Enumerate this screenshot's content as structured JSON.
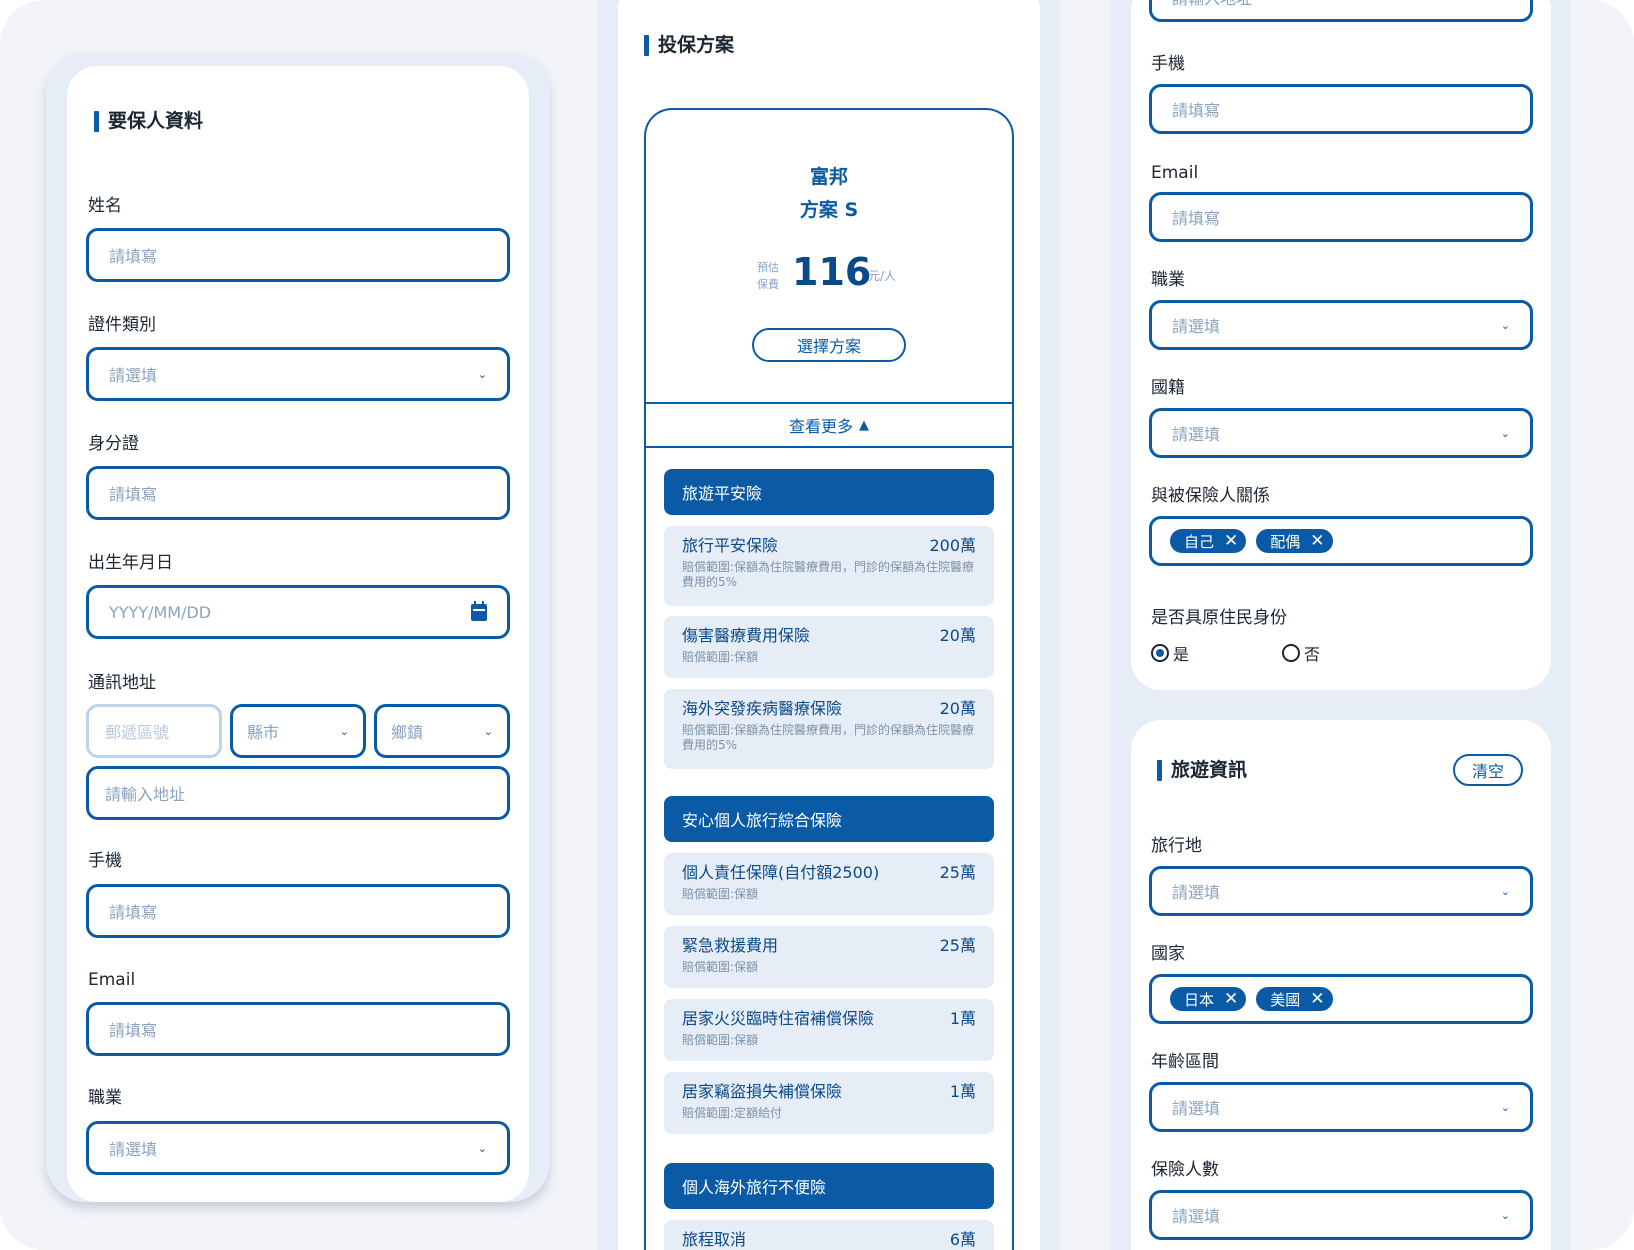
{
  "policyholder": {
    "title": "要保人資料",
    "name": {
      "label": "姓名",
      "placeholder": "請填寫"
    },
    "id_type": {
      "label": "證件類別",
      "placeholder": "請選填"
    },
    "id_number": {
      "label": "身分證",
      "placeholder": "請填寫"
    },
    "birthday": {
      "label": "出生年月日",
      "placeholder": "YYYY/MM/DD"
    },
    "address": {
      "label": "通訊地址",
      "zip_placeholder": "郵遞區號",
      "city_placeholder": "縣市",
      "town_placeholder": "鄉鎮",
      "street_placeholder": "請輸入地址"
    },
    "mobile": {
      "label": "手機",
      "placeholder": "請填寫"
    },
    "email": {
      "label": "Email",
      "placeholder": "請填寫"
    },
    "job": {
      "label": "職業",
      "placeholder": "請選填"
    }
  },
  "plan": {
    "title": "投保方案",
    "insurer": "富邦",
    "plan_name": "方案 S",
    "premium_label_1": "預估",
    "premium_label_2": "保費",
    "premium": "116",
    "premium_unit": "元/人",
    "select_button": "選擇方案",
    "more_label": "查看更多",
    "categories": [
      {
        "name": "旅遊平安險",
        "items": [
          {
            "name": "旅行平安保險",
            "amount": "200萬",
            "desc": "賠償範圍:保額為住院醫療費用，門診的保額為住院醫療費用的5%"
          },
          {
            "name": "傷害醫療費用保險",
            "amount": "20萬",
            "desc": "賠償範圍:保額"
          },
          {
            "name": "海外突發疾病醫療保險",
            "amount": "20萬",
            "desc": "賠償範圍:保額為住院醫療費用，門診的保額為住院醫療費用的5%"
          }
        ]
      },
      {
        "name": "安心個人旅行綜合保險",
        "items": [
          {
            "name": "個人責任保障(自付額2500)",
            "amount": "25萬",
            "desc": "賠償範圍:保額"
          },
          {
            "name": "緊急救援費用",
            "amount": "25萬",
            "desc": "賠償範圍:保額"
          },
          {
            "name": "居家火災臨時住宿補償保險",
            "amount": "1萬",
            "desc": "賠償範圍:保額"
          },
          {
            "name": "居家竊盜損失補償保險",
            "amount": "1萬",
            "desc": "賠償範圍:定額給付"
          }
        ]
      },
      {
        "name": "個人海外旅行不便險",
        "items": [
          {
            "name": "旅程取消",
            "amount": "6萬",
            "desc": ""
          }
        ]
      }
    ]
  },
  "right": {
    "top_address_placeholder": "請輸入地址",
    "mobile": {
      "label": "手機",
      "placeholder": "請填寫"
    },
    "email": {
      "label": "Email",
      "placeholder": "請填寫"
    },
    "job": {
      "label": "職業",
      "placeholder": "請選填"
    },
    "nationality": {
      "label": "國籍",
      "placeholder": "請選填"
    },
    "relation": {
      "label": "與被保險人關係",
      "chips": [
        "自己",
        "配偶"
      ]
    },
    "aboriginal": {
      "label": "是否具原住民身份",
      "yes": "是",
      "no": "否"
    }
  },
  "travel": {
    "title": "旅遊資訊",
    "clear_button": "清空",
    "destination": {
      "label": "旅行地",
      "placeholder": "請選填"
    },
    "country": {
      "label": "國家",
      "chips": [
        "日本",
        "美國"
      ]
    },
    "age_range": {
      "label": "年齡區間",
      "placeholder": "請選填"
    },
    "insured_count": {
      "label": "保險人數",
      "placeholder": "請選填"
    }
  },
  "icons": {
    "chevron": "chevron-down-icon",
    "calendar": "calendar-icon",
    "remove": "close-icon",
    "expand": "triangle-up-icon"
  },
  "colors": {
    "primary": "#0a5aa5",
    "frame": "#e6edf6",
    "item_bg": "#e6edf6",
    "background": "#f2f4f7"
  }
}
